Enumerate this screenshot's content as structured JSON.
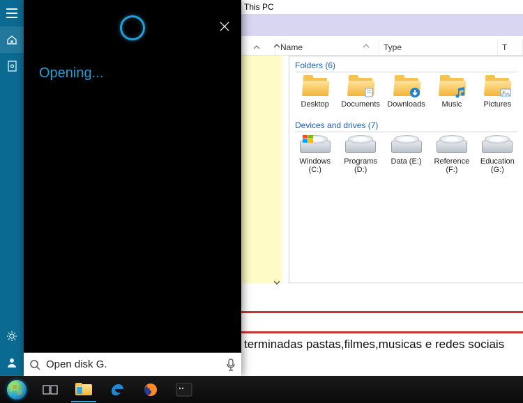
{
  "explorer": {
    "title": "This PC",
    "columns": {
      "name": "Name",
      "type": "Type",
      "t": "T"
    },
    "group_folders": {
      "label": "Folders",
      "count": 6
    },
    "group_drives": {
      "label": "Devices and drives",
      "count": 7
    },
    "folders": [
      {
        "name": "Desktop",
        "badge": null
      },
      {
        "name": "Documents",
        "badge": "doc"
      },
      {
        "name": "Downloads",
        "badge": "down"
      },
      {
        "name": "Music",
        "badge": "music"
      },
      {
        "name": "Pictures",
        "badge": "pic"
      }
    ],
    "drives": [
      {
        "name": "Windows (C:)",
        "flag": true
      },
      {
        "name": "Programs (D:)",
        "flag": false
      },
      {
        "name": "Data (E:)",
        "flag": false
      },
      {
        "name": "Reference (F:)",
        "flag": false
      },
      {
        "name": "Education (G:)",
        "flag": false
      }
    ]
  },
  "page_text": "terminadas pastas,filmes,musicas e redes sociais",
  "cortana": {
    "status_text": "Opening...",
    "search_value": "Open disk G."
  },
  "rail": {
    "items": [
      "menu",
      "home",
      "notebook"
    ],
    "bottom": [
      "settings",
      "feedback"
    ]
  },
  "taskbar": {
    "items": [
      "start",
      "taskview",
      "explorer",
      "edge",
      "firefox",
      "terminal"
    ]
  }
}
